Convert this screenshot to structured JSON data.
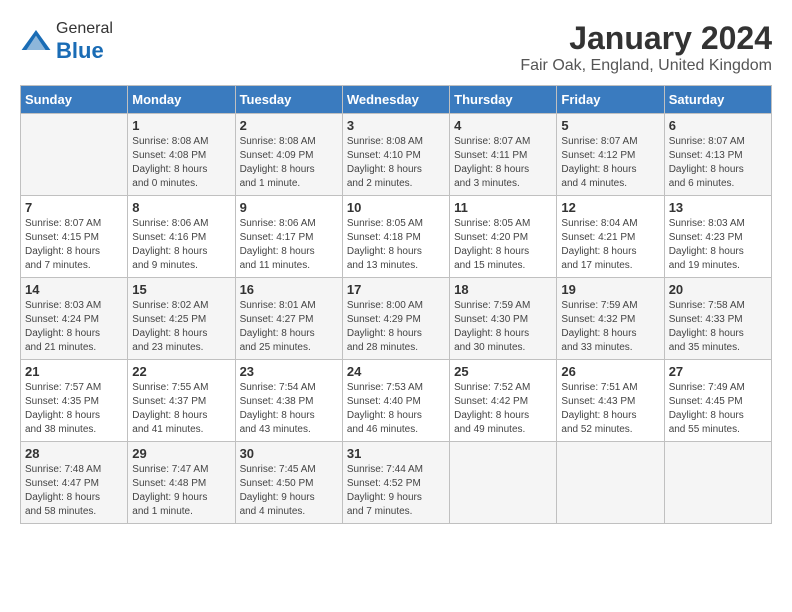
{
  "header": {
    "logo_general": "General",
    "logo_blue": "Blue",
    "main_title": "January 2024",
    "subtitle": "Fair Oak, England, United Kingdom"
  },
  "weekdays": [
    "Sunday",
    "Monday",
    "Tuesday",
    "Wednesday",
    "Thursday",
    "Friday",
    "Saturday"
  ],
  "weeks": [
    [
      {
        "day": "",
        "info": ""
      },
      {
        "day": "1",
        "info": "Sunrise: 8:08 AM\nSunset: 4:08 PM\nDaylight: 8 hours\nand 0 minutes."
      },
      {
        "day": "2",
        "info": "Sunrise: 8:08 AM\nSunset: 4:09 PM\nDaylight: 8 hours\nand 1 minute."
      },
      {
        "day": "3",
        "info": "Sunrise: 8:08 AM\nSunset: 4:10 PM\nDaylight: 8 hours\nand 2 minutes."
      },
      {
        "day": "4",
        "info": "Sunrise: 8:07 AM\nSunset: 4:11 PM\nDaylight: 8 hours\nand 3 minutes."
      },
      {
        "day": "5",
        "info": "Sunrise: 8:07 AM\nSunset: 4:12 PM\nDaylight: 8 hours\nand 4 minutes."
      },
      {
        "day": "6",
        "info": "Sunrise: 8:07 AM\nSunset: 4:13 PM\nDaylight: 8 hours\nand 6 minutes."
      }
    ],
    [
      {
        "day": "7",
        "info": "Sunrise: 8:07 AM\nSunset: 4:15 PM\nDaylight: 8 hours\nand 7 minutes."
      },
      {
        "day": "8",
        "info": "Sunrise: 8:06 AM\nSunset: 4:16 PM\nDaylight: 8 hours\nand 9 minutes."
      },
      {
        "day": "9",
        "info": "Sunrise: 8:06 AM\nSunset: 4:17 PM\nDaylight: 8 hours\nand 11 minutes."
      },
      {
        "day": "10",
        "info": "Sunrise: 8:05 AM\nSunset: 4:18 PM\nDaylight: 8 hours\nand 13 minutes."
      },
      {
        "day": "11",
        "info": "Sunrise: 8:05 AM\nSunset: 4:20 PM\nDaylight: 8 hours\nand 15 minutes."
      },
      {
        "day": "12",
        "info": "Sunrise: 8:04 AM\nSunset: 4:21 PM\nDaylight: 8 hours\nand 17 minutes."
      },
      {
        "day": "13",
        "info": "Sunrise: 8:03 AM\nSunset: 4:23 PM\nDaylight: 8 hours\nand 19 minutes."
      }
    ],
    [
      {
        "day": "14",
        "info": "Sunrise: 8:03 AM\nSunset: 4:24 PM\nDaylight: 8 hours\nand 21 minutes."
      },
      {
        "day": "15",
        "info": "Sunrise: 8:02 AM\nSunset: 4:25 PM\nDaylight: 8 hours\nand 23 minutes."
      },
      {
        "day": "16",
        "info": "Sunrise: 8:01 AM\nSunset: 4:27 PM\nDaylight: 8 hours\nand 25 minutes."
      },
      {
        "day": "17",
        "info": "Sunrise: 8:00 AM\nSunset: 4:29 PM\nDaylight: 8 hours\nand 28 minutes."
      },
      {
        "day": "18",
        "info": "Sunrise: 7:59 AM\nSunset: 4:30 PM\nDaylight: 8 hours\nand 30 minutes."
      },
      {
        "day": "19",
        "info": "Sunrise: 7:59 AM\nSunset: 4:32 PM\nDaylight: 8 hours\nand 33 minutes."
      },
      {
        "day": "20",
        "info": "Sunrise: 7:58 AM\nSunset: 4:33 PM\nDaylight: 8 hours\nand 35 minutes."
      }
    ],
    [
      {
        "day": "21",
        "info": "Sunrise: 7:57 AM\nSunset: 4:35 PM\nDaylight: 8 hours\nand 38 minutes."
      },
      {
        "day": "22",
        "info": "Sunrise: 7:55 AM\nSunset: 4:37 PM\nDaylight: 8 hours\nand 41 minutes."
      },
      {
        "day": "23",
        "info": "Sunrise: 7:54 AM\nSunset: 4:38 PM\nDaylight: 8 hours\nand 43 minutes."
      },
      {
        "day": "24",
        "info": "Sunrise: 7:53 AM\nSunset: 4:40 PM\nDaylight: 8 hours\nand 46 minutes."
      },
      {
        "day": "25",
        "info": "Sunrise: 7:52 AM\nSunset: 4:42 PM\nDaylight: 8 hours\nand 49 minutes."
      },
      {
        "day": "26",
        "info": "Sunrise: 7:51 AM\nSunset: 4:43 PM\nDaylight: 8 hours\nand 52 minutes."
      },
      {
        "day": "27",
        "info": "Sunrise: 7:49 AM\nSunset: 4:45 PM\nDaylight: 8 hours\nand 55 minutes."
      }
    ],
    [
      {
        "day": "28",
        "info": "Sunrise: 7:48 AM\nSunset: 4:47 PM\nDaylight: 8 hours\nand 58 minutes."
      },
      {
        "day": "29",
        "info": "Sunrise: 7:47 AM\nSunset: 4:48 PM\nDaylight: 9 hours\nand 1 minute."
      },
      {
        "day": "30",
        "info": "Sunrise: 7:45 AM\nSunset: 4:50 PM\nDaylight: 9 hours\nand 4 minutes."
      },
      {
        "day": "31",
        "info": "Sunrise: 7:44 AM\nSunset: 4:52 PM\nDaylight: 9 hours\nand 7 minutes."
      },
      {
        "day": "",
        "info": ""
      },
      {
        "day": "",
        "info": ""
      },
      {
        "day": "",
        "info": ""
      }
    ]
  ]
}
